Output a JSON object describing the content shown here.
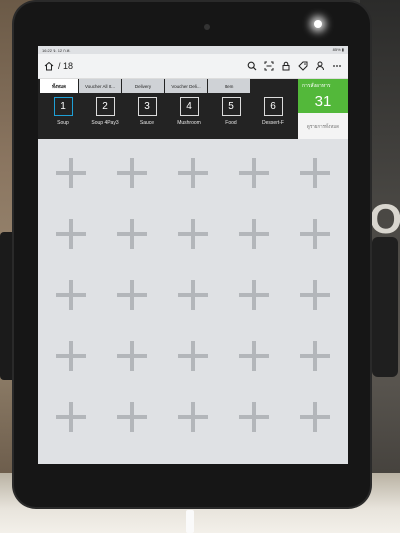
{
  "app": {
    "title": "/ 18",
    "status_left": "16:22 จ. 12 ก.พ.",
    "status_right": "85% ▮"
  },
  "toolbar_icons": [
    "search-icon",
    "scan-icon",
    "lock-icon",
    "tag-icon",
    "user-tag-icon",
    "more-icon"
  ],
  "tabs": [
    {
      "label": "ทั้งหมด",
      "active": true
    },
    {
      "label": "Voucher All It...",
      "active": false
    },
    {
      "label": "Delivery",
      "active": false
    },
    {
      "label": "Voucher Deli...",
      "active": false
    },
    {
      "label": "Item",
      "active": false
    }
  ],
  "categories": [
    {
      "number": "1",
      "label": "Soup"
    },
    {
      "number": "2",
      "label": "Soup 4Pay3"
    },
    {
      "number": "3",
      "label": "Sauce"
    },
    {
      "number": "4",
      "label": "Mushroom"
    },
    {
      "number": "5",
      "label": "Food"
    },
    {
      "number": "6",
      "label": "Dessert-F"
    }
  ],
  "summary_card": {
    "label": "การสั่งอาหาร",
    "count": "31",
    "sub_label": "ดูรายการทั้งหมด",
    "color": "#53b83a"
  },
  "environment": {
    "sign_text": "MO"
  }
}
